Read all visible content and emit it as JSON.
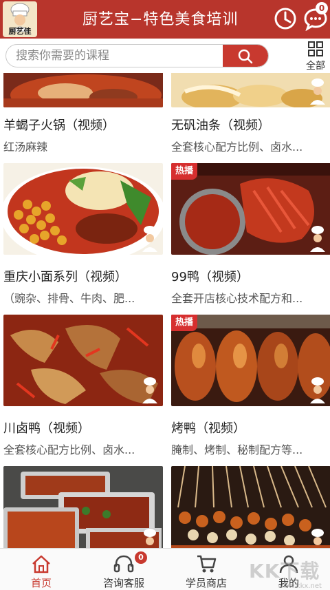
{
  "header": {
    "logo_text": "厨艺佳",
    "title": "厨艺宝−特色美食培训",
    "message_badge": "0"
  },
  "search": {
    "placeholder": "搜索你需要的课程",
    "all_label": "全部"
  },
  "courses": [
    {
      "title": "羊蝎子火锅（视频）",
      "subtitle": "红汤麻辣"
    },
    {
      "title": "无矾油条（视频）",
      "subtitle": "全套核心配方比例、卤水..."
    },
    {
      "title": "重庆小面系列（视频）",
      "subtitle": "（豌杂、排骨、牛肉、肥..."
    },
    {
      "title": "99鸭（视频）",
      "subtitle": "全套开店核心技术配方和...",
      "tag": "热播"
    },
    {
      "title": "川卤鸭（视频）",
      "subtitle": "全套核心配方比例、卤水..."
    },
    {
      "title": "烤鸭（视频）",
      "subtitle": "腌制、烤制、秘制配方等...",
      "tag": "热播"
    },
    {
      "title": "",
      "subtitle": ""
    },
    {
      "title": "",
      "subtitle": ""
    }
  ],
  "bottom_nav": {
    "home": "首页",
    "service": "咨询客服",
    "service_badge": "0",
    "shop": "学员商店",
    "mine": "我的"
  },
  "watermark": {
    "brand": "KK下载",
    "site": "www.kkx.net"
  },
  "colors": {
    "brand_red": "#b8352c",
    "accent_red": "#c8392f",
    "hot_tag": "#d62f2f"
  },
  "icons": [
    "history-icon",
    "message-icon",
    "search-icon",
    "grid-icon",
    "home-icon",
    "headset-icon",
    "cart-icon",
    "user-icon"
  ]
}
